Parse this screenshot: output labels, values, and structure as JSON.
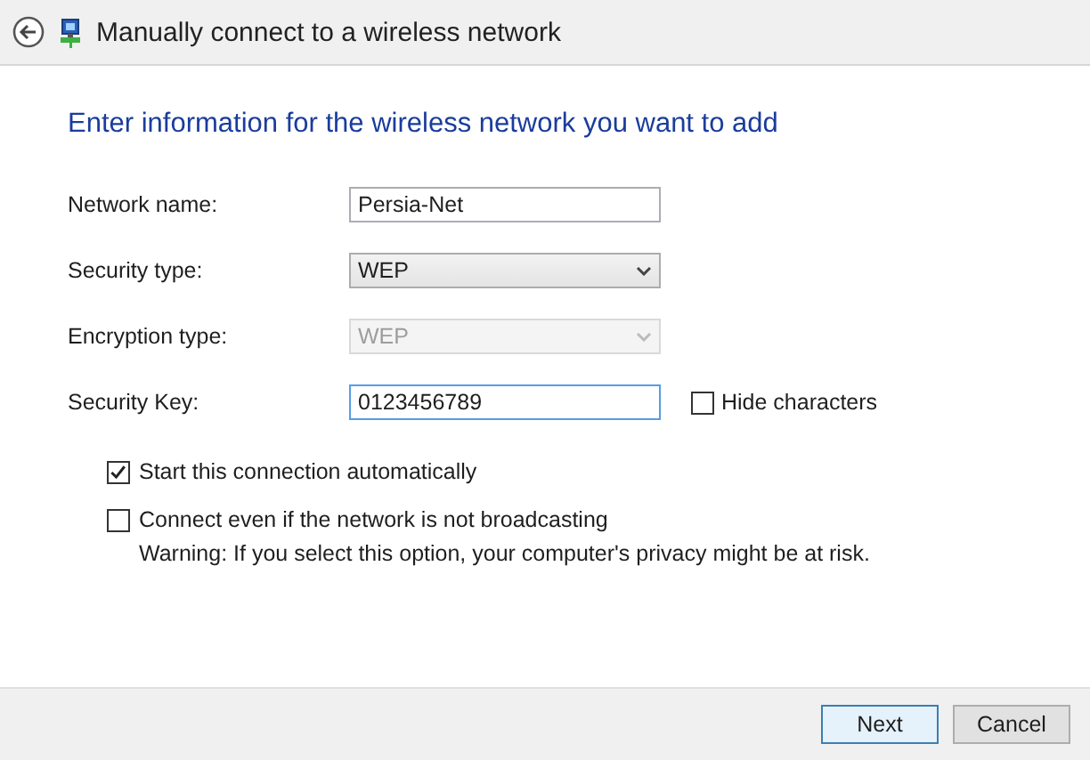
{
  "window": {
    "title": "Manually connect to a wireless network"
  },
  "heading": "Enter information for the wireless network you want to add",
  "fields": [
    {
      "kind": "text",
      "label": "Network name:",
      "value": "Persia-Net",
      "disabled": false,
      "focused": false
    },
    {
      "kind": "dropdown",
      "label": "Security type:",
      "value": "WEP",
      "disabled": false,
      "focused": false
    },
    {
      "kind": "dropdown",
      "label": "Encryption type:",
      "value": "WEP",
      "disabled": true,
      "focused": false
    },
    {
      "kind": "text",
      "label": "Security Key:",
      "value": "0123456789",
      "disabled": false,
      "focused": true,
      "option": {
        "label": "Hide characters",
        "checked": false
      }
    }
  ],
  "options": [
    {
      "label": "Start this connection automatically",
      "checked": true
    },
    {
      "label": "Connect even if the network is not broadcasting",
      "checked": false,
      "note": "Warning: If you select this option, your computer's privacy might be at risk."
    }
  ],
  "buttons": [
    {
      "label": "Next",
      "default": true
    },
    {
      "label": "Cancel",
      "default": false
    }
  ]
}
